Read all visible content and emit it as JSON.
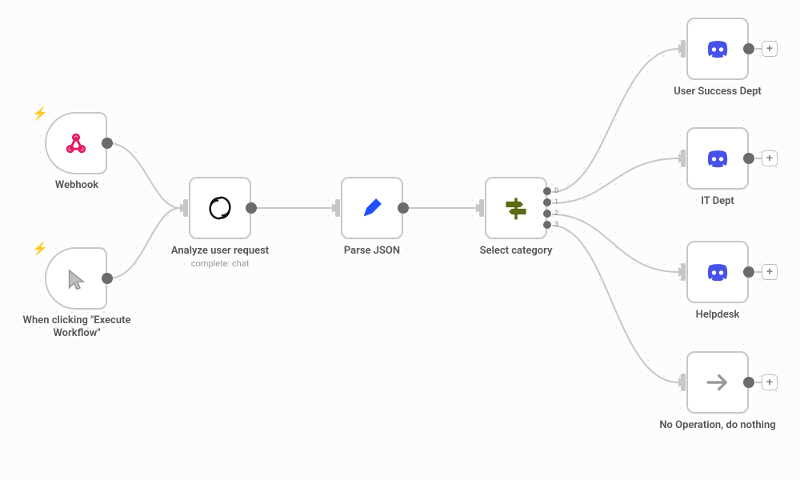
{
  "nodes": {
    "webhook": {
      "label": "Webhook"
    },
    "click": {
      "label": "When clicking \"Execute Workflow\""
    },
    "analyze": {
      "label": "Analyze user request",
      "sub": "complete: chat"
    },
    "parse": {
      "label": "Parse JSON"
    },
    "select": {
      "label": "Select category"
    },
    "dept0": {
      "label": "User Success Dept"
    },
    "dept1": {
      "label": "IT Dept"
    },
    "dept2": {
      "label": "Helpdesk"
    },
    "noop": {
      "label": "No Operation, do nothing"
    }
  },
  "switch_ports": [
    "0",
    "1",
    "2",
    "3"
  ]
}
